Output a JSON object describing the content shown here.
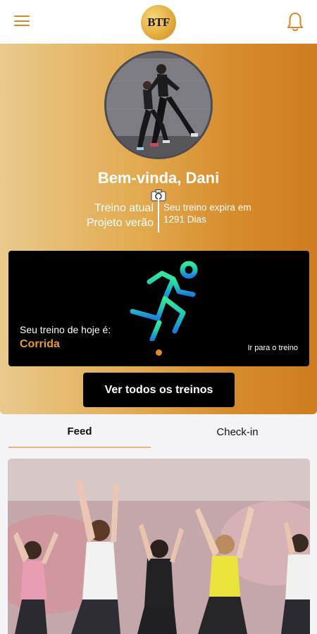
{
  "header": {
    "menu_icon": "hamburger-menu-icon",
    "logo_text": "BTF",
    "bell_icon": "bell-icon",
    "accent": "#d4882a"
  },
  "hero": {
    "greeting": "Bem-vinda, Dani",
    "current_label": "Treino atual",
    "current_value": "Projeto verão",
    "expire_label": "Seu treino expira em",
    "expire_value": "1291 Dias",
    "camera_icon": "camera-icon"
  },
  "card": {
    "today_label": "Seu treino de hoje é:",
    "today_value": "Corrida",
    "go_link": "Ir para o treino",
    "icon": "running-person-icon"
  },
  "all_button": "Ver todos os treinos",
  "tabs": [
    {
      "label": "Feed",
      "active": true
    },
    {
      "label": "Check-in",
      "active": false
    }
  ]
}
